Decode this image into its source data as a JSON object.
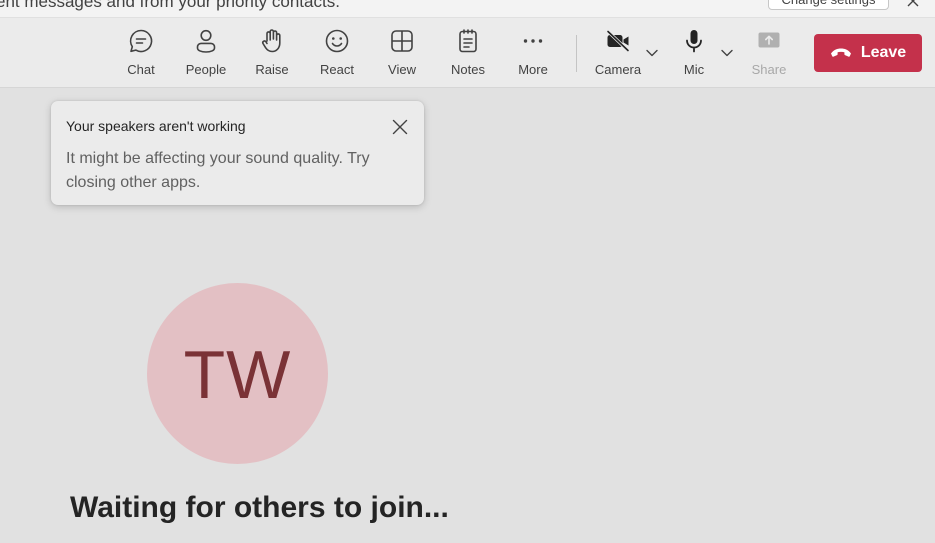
{
  "notice": {
    "text": "ent messages and from your priority contacts.",
    "button_label": "Change settings"
  },
  "toolbar": {
    "items": [
      {
        "label": "Chat",
        "icon": "chat-icon"
      },
      {
        "label": "People",
        "icon": "people-icon"
      },
      {
        "label": "Raise",
        "icon": "raise-hand-icon"
      },
      {
        "label": "React",
        "icon": "react-icon"
      },
      {
        "label": "View",
        "icon": "view-icon"
      },
      {
        "label": "Notes",
        "icon": "notes-icon"
      },
      {
        "label": "More",
        "icon": "more-icon"
      },
      {
        "label": "Camera",
        "icon": "camera-off-icon"
      },
      {
        "label": "Mic",
        "icon": "mic-icon"
      },
      {
        "label": "Share",
        "icon": "share-icon"
      }
    ],
    "leave_label": "Leave",
    "leave_color": "#c4314b"
  },
  "toast": {
    "title": "Your speakers aren't working",
    "body": "It might be affecting your sound quality. Try closing other apps."
  },
  "participant": {
    "initials": "TW",
    "avatar_color": "#e3c0c4"
  },
  "status": {
    "waiting_text": "Waiting for others to join..."
  }
}
